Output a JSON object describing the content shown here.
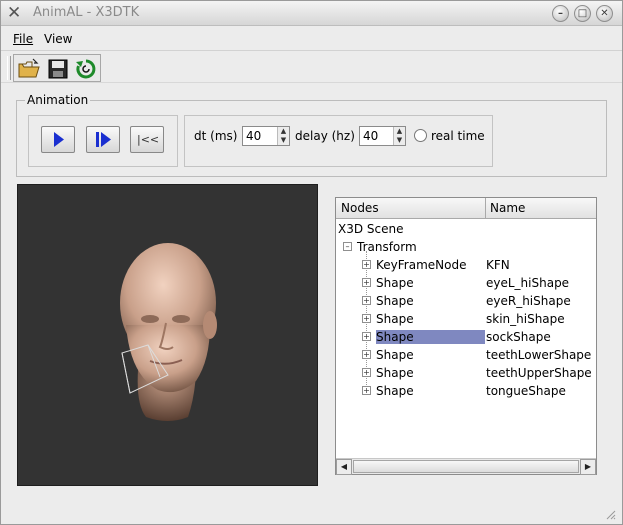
{
  "window": {
    "title": "AnimAL - X3DTK"
  },
  "menubar": {
    "file": "File",
    "view": "View"
  },
  "toolbar": {
    "icons": [
      "open-folder-icon",
      "save-disk-icon",
      "reload-icon"
    ]
  },
  "animation": {
    "group_title": "Animation",
    "rewind_label": "|<<",
    "dt_label": "dt (ms)",
    "dt_value": "40",
    "delay_label": "delay (hz)",
    "delay_value": "40",
    "realtime_label": "real time",
    "realtime_checked": false
  },
  "tree": {
    "col_nodes": "Nodes",
    "col_name": "Name",
    "root": "X3D Scene",
    "transform": "Transform",
    "rows": [
      {
        "node": "KeyFrameNode",
        "name": "KFN",
        "selected": false
      },
      {
        "node": "Shape",
        "name": "eyeL_hiShape",
        "selected": false
      },
      {
        "node": "Shape",
        "name": "eyeR_hiShape",
        "selected": false
      },
      {
        "node": "Shape",
        "name": "skin_hiShape",
        "selected": false
      },
      {
        "node": "Shape",
        "name": "sockShape",
        "selected": true
      },
      {
        "node": "Shape",
        "name": "teethLowerShape",
        "selected": false
      },
      {
        "node": "Shape",
        "name": "teethUpperShape",
        "selected": false
      },
      {
        "node": "Shape",
        "name": "tongueShape",
        "selected": false
      }
    ]
  },
  "colors": {
    "viewport_bg": "#333333",
    "selection": "#7f88c0",
    "play_blue": "#1a2fd0",
    "skin": "#c8a08a"
  }
}
